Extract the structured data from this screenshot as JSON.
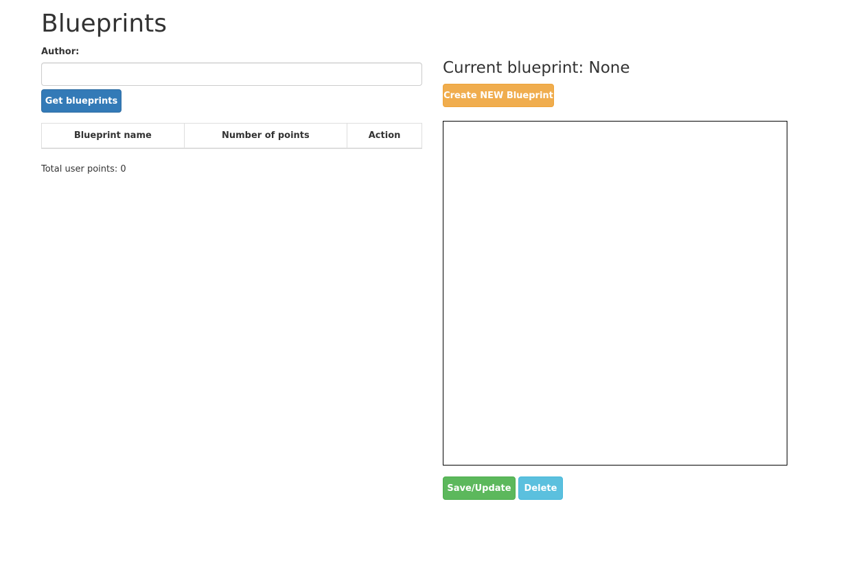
{
  "page": {
    "title": "Blueprints"
  },
  "author": {
    "label": "Author:",
    "value": "",
    "placeholder": ""
  },
  "buttons": {
    "get_blueprints": "Get blueprints",
    "create_new": "Create NEW Blueprint",
    "save_update": "Save/Update",
    "delete": "Delete"
  },
  "table": {
    "headers": [
      "Blueprint name",
      "Number of points",
      "Action"
    ],
    "rows": []
  },
  "total": {
    "text": "Total user points: 0"
  },
  "current": {
    "text": "Current blueprint: None"
  },
  "colors": {
    "primary": "#337ab7",
    "warning": "#f0ad4e",
    "success": "#5cb85c",
    "info": "#5bc0de"
  }
}
